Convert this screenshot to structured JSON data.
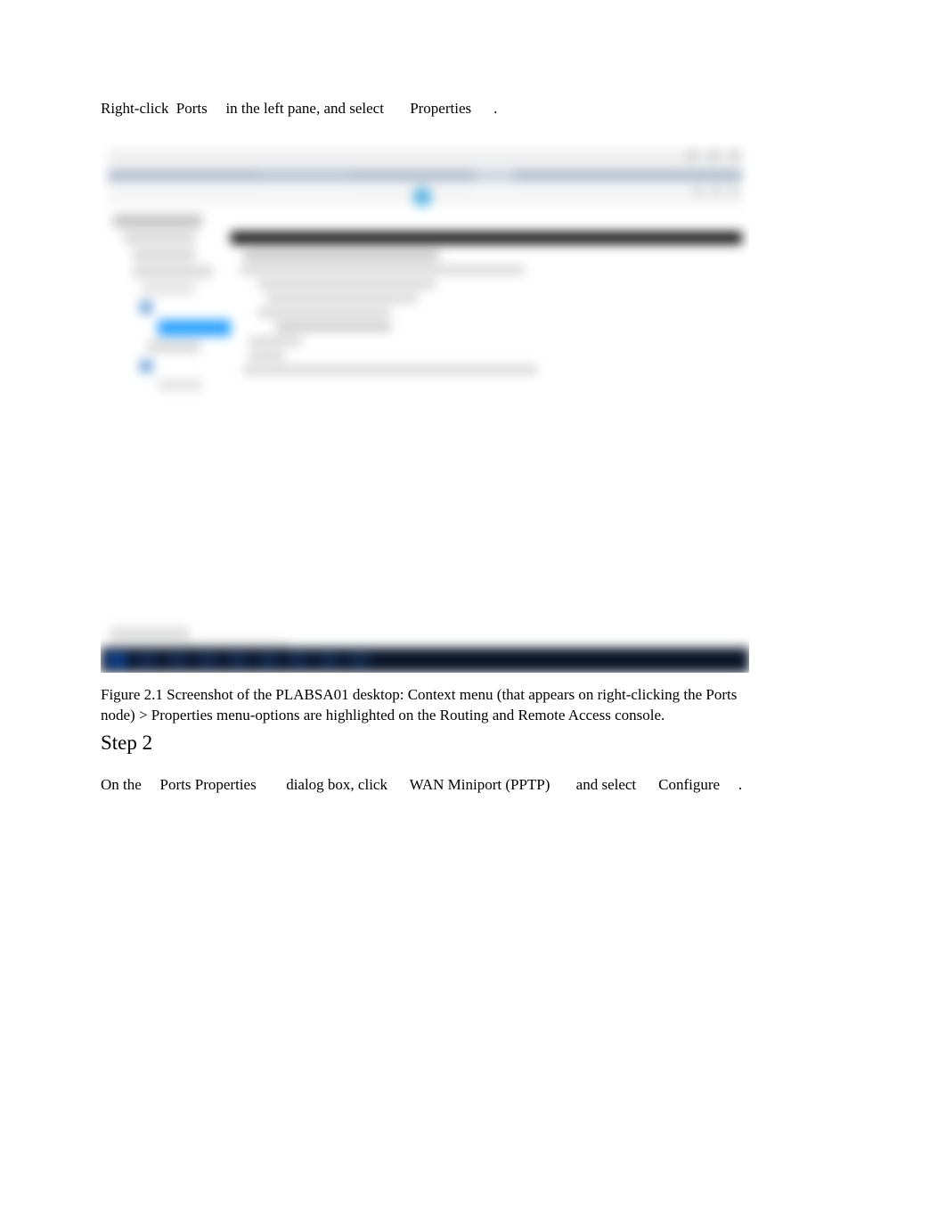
{
  "step1": {
    "pre": "Right-click",
    "ports": "Ports",
    "mid": "in the left pane, and select",
    "properties": "Properties",
    "dot": "."
  },
  "caption": "Figure 2.1 Screenshot of the PLABSA01 desktop: Context menu (that appears on right-clicking the Ports node) > Properties menu-options are highlighted on the Routing and Remote Access console.",
  "step_heading": "Step 2",
  "step2": {
    "pre": "On the",
    "pp": "Ports Properties",
    "mid1": "dialog box, click",
    "wan": "WAN Miniport (PPTP)",
    "mid2": "and select",
    "conf": "Configure",
    "dot": "."
  }
}
